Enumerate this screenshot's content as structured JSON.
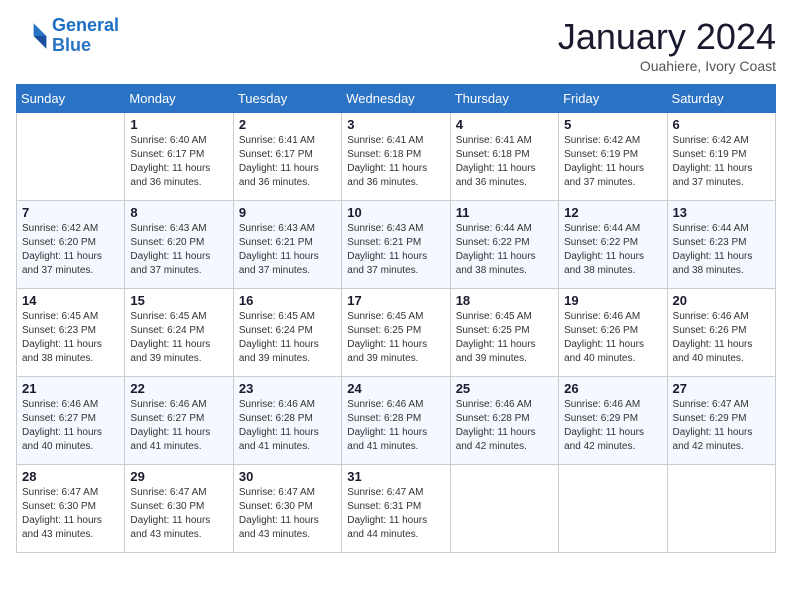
{
  "logo": {
    "line1": "General",
    "line2": "Blue"
  },
  "title": "January 2024",
  "subtitle": "Ouahiere, Ivory Coast",
  "days": [
    "Sunday",
    "Monday",
    "Tuesday",
    "Wednesday",
    "Thursday",
    "Friday",
    "Saturday"
  ],
  "weeks": [
    [
      {
        "day": "",
        "info": ""
      },
      {
        "day": "1",
        "info": "Sunrise: 6:40 AM\nSunset: 6:17 PM\nDaylight: 11 hours and 36 minutes."
      },
      {
        "day": "2",
        "info": "Sunrise: 6:41 AM\nSunset: 6:17 PM\nDaylight: 11 hours and 36 minutes."
      },
      {
        "day": "3",
        "info": "Sunrise: 6:41 AM\nSunset: 6:18 PM\nDaylight: 11 hours and 36 minutes."
      },
      {
        "day": "4",
        "info": "Sunrise: 6:41 AM\nSunset: 6:18 PM\nDaylight: 11 hours and 36 minutes."
      },
      {
        "day": "5",
        "info": "Sunrise: 6:42 AM\nSunset: 6:19 PM\nDaylight: 11 hours and 37 minutes."
      },
      {
        "day": "6",
        "info": "Sunrise: 6:42 AM\nSunset: 6:19 PM\nDaylight: 11 hours and 37 minutes."
      }
    ],
    [
      {
        "day": "7",
        "info": "Sunrise: 6:42 AM\nSunset: 6:20 PM\nDaylight: 11 hours and 37 minutes."
      },
      {
        "day": "8",
        "info": "Sunrise: 6:43 AM\nSunset: 6:20 PM\nDaylight: 11 hours and 37 minutes."
      },
      {
        "day": "9",
        "info": "Sunrise: 6:43 AM\nSunset: 6:21 PM\nDaylight: 11 hours and 37 minutes."
      },
      {
        "day": "10",
        "info": "Sunrise: 6:43 AM\nSunset: 6:21 PM\nDaylight: 11 hours and 37 minutes."
      },
      {
        "day": "11",
        "info": "Sunrise: 6:44 AM\nSunset: 6:22 PM\nDaylight: 11 hours and 38 minutes."
      },
      {
        "day": "12",
        "info": "Sunrise: 6:44 AM\nSunset: 6:22 PM\nDaylight: 11 hours and 38 minutes."
      },
      {
        "day": "13",
        "info": "Sunrise: 6:44 AM\nSunset: 6:23 PM\nDaylight: 11 hours and 38 minutes."
      }
    ],
    [
      {
        "day": "14",
        "info": "Sunrise: 6:45 AM\nSunset: 6:23 PM\nDaylight: 11 hours and 38 minutes."
      },
      {
        "day": "15",
        "info": "Sunrise: 6:45 AM\nSunset: 6:24 PM\nDaylight: 11 hours and 39 minutes."
      },
      {
        "day": "16",
        "info": "Sunrise: 6:45 AM\nSunset: 6:24 PM\nDaylight: 11 hours and 39 minutes."
      },
      {
        "day": "17",
        "info": "Sunrise: 6:45 AM\nSunset: 6:25 PM\nDaylight: 11 hours and 39 minutes."
      },
      {
        "day": "18",
        "info": "Sunrise: 6:45 AM\nSunset: 6:25 PM\nDaylight: 11 hours and 39 minutes."
      },
      {
        "day": "19",
        "info": "Sunrise: 6:46 AM\nSunset: 6:26 PM\nDaylight: 11 hours and 40 minutes."
      },
      {
        "day": "20",
        "info": "Sunrise: 6:46 AM\nSunset: 6:26 PM\nDaylight: 11 hours and 40 minutes."
      }
    ],
    [
      {
        "day": "21",
        "info": "Sunrise: 6:46 AM\nSunset: 6:27 PM\nDaylight: 11 hours and 40 minutes."
      },
      {
        "day": "22",
        "info": "Sunrise: 6:46 AM\nSunset: 6:27 PM\nDaylight: 11 hours and 41 minutes."
      },
      {
        "day": "23",
        "info": "Sunrise: 6:46 AM\nSunset: 6:28 PM\nDaylight: 11 hours and 41 minutes."
      },
      {
        "day": "24",
        "info": "Sunrise: 6:46 AM\nSunset: 6:28 PM\nDaylight: 11 hours and 41 minutes."
      },
      {
        "day": "25",
        "info": "Sunrise: 6:46 AM\nSunset: 6:28 PM\nDaylight: 11 hours and 42 minutes."
      },
      {
        "day": "26",
        "info": "Sunrise: 6:46 AM\nSunset: 6:29 PM\nDaylight: 11 hours and 42 minutes."
      },
      {
        "day": "27",
        "info": "Sunrise: 6:47 AM\nSunset: 6:29 PM\nDaylight: 11 hours and 42 minutes."
      }
    ],
    [
      {
        "day": "28",
        "info": "Sunrise: 6:47 AM\nSunset: 6:30 PM\nDaylight: 11 hours and 43 minutes."
      },
      {
        "day": "29",
        "info": "Sunrise: 6:47 AM\nSunset: 6:30 PM\nDaylight: 11 hours and 43 minutes."
      },
      {
        "day": "30",
        "info": "Sunrise: 6:47 AM\nSunset: 6:30 PM\nDaylight: 11 hours and 43 minutes."
      },
      {
        "day": "31",
        "info": "Sunrise: 6:47 AM\nSunset: 6:31 PM\nDaylight: 11 hours and 44 minutes."
      },
      {
        "day": "",
        "info": ""
      },
      {
        "day": "",
        "info": ""
      },
      {
        "day": "",
        "info": ""
      }
    ]
  ]
}
